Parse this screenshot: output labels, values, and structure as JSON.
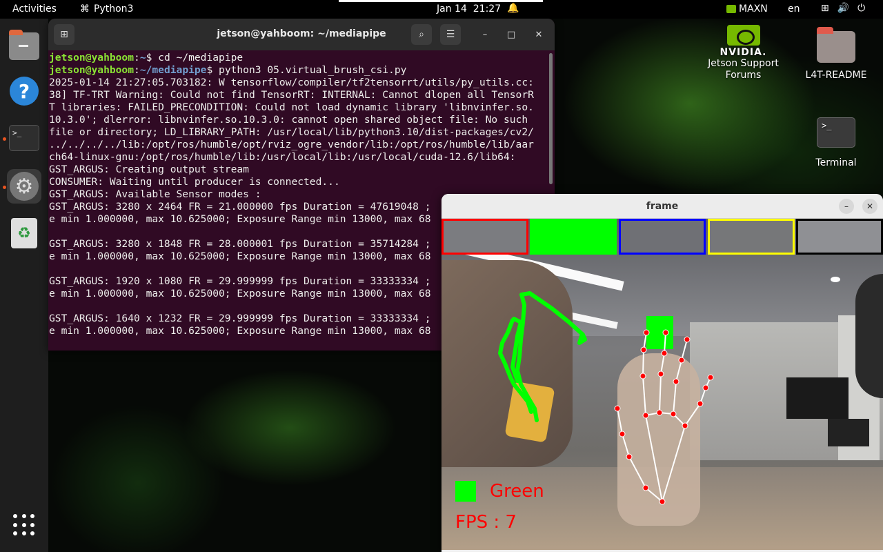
{
  "topbar": {
    "activities": "Activities",
    "app_name": "Python3",
    "date": "Jan 14",
    "time": "21:27",
    "power_mode": "MAXN",
    "language": "en"
  },
  "terminal": {
    "title": "jetson@yahboom: ~/mediapipe",
    "lines": [
      {
        "user": "jetson@yahboom",
        "path": "~",
        "cmd": "$ cd ~/mediapipe"
      },
      {
        "user": "jetson@yahboom",
        "path": "~/mediapipe",
        "cmd": "$ python3 05.virtual_brush_csi.py"
      }
    ],
    "output": [
      "2025-01-14 21:27:05.703182: W tensorflow/compiler/tf2tensorrt/utils/py_utils.cc:",
      "38] TF-TRT Warning: Could not find TensorRT: INTERNAL: Cannot dlopen all TensorR",
      "T libraries: FAILED_PRECONDITION: Could not load dynamic library 'libnvinfer.so.",
      "10.3.0'; dlerror: libnvinfer.so.10.3.0: cannot open shared object file: No such",
      "file or directory; LD_LIBRARY_PATH: /usr/local/lib/python3.10/dist-packages/cv2/",
      "../../../../lib:/opt/ros/humble/opt/rviz_ogre_vendor/lib:/opt/ros/humble/lib/aar",
      "ch64-linux-gnu:/opt/ros/humble/lib:/usr/local/lib:/usr/local/cuda-12.6/lib64:",
      "GST_ARGUS: Creating output stream",
      "CONSUMER: Waiting until producer is connected...",
      "GST_ARGUS: Available Sensor modes :",
      "GST_ARGUS: 3280 x 2464 FR = 21.000000 fps Duration = 47619048 ;",
      "e min 1.000000, max 10.625000; Exposure Range min 13000, max 68",
      "",
      "GST_ARGUS: 3280 x 1848 FR = 28.000001 fps Duration = 35714284 ;",
      "e min 1.000000, max 10.625000; Exposure Range min 13000, max 68",
      "",
      "GST_ARGUS: 1920 x 1080 FR = 29.999999 fps Duration = 33333334 ;",
      "e min 1.000000, max 10.625000; Exposure Range min 13000, max 68",
      "",
      "GST_ARGUS: 1640 x 1232 FR = 29.999999 fps Duration = 33333334 ;",
      "e min 1.000000, max 10.625000; Exposure Range min 13000, max 68"
    ]
  },
  "desktop": {
    "nvidia_brand": "NVIDIA.",
    "nvidia_label": "Jetson Support Forums",
    "readme_label": "L4T-README",
    "terminal_label": "Terminal"
  },
  "frame": {
    "title": "frame",
    "color_name": "Green",
    "fps_text": "FPS : 7"
  },
  "colors": {
    "ubuntu_orange": "#e95420",
    "terminal_bg": "#300a24",
    "prompt_user": "#8ae234",
    "prompt_path": "#729fcf",
    "brush_color": "#00ff00",
    "overlay_text": "#ff0000",
    "nvidia_green": "#76b900"
  },
  "icons": [
    "activities-menu",
    "python-app-icon",
    "bell-icon",
    "nvidia-icon",
    "network-icon",
    "volume-icon",
    "power-icon",
    "files-icon",
    "help-icon",
    "terminal-icon",
    "settings-icon",
    "trash-icon",
    "show-apps-icon",
    "new-tab-icon",
    "search-icon",
    "menu-icon",
    "minimize-icon",
    "maximize-icon",
    "close-icon"
  ]
}
